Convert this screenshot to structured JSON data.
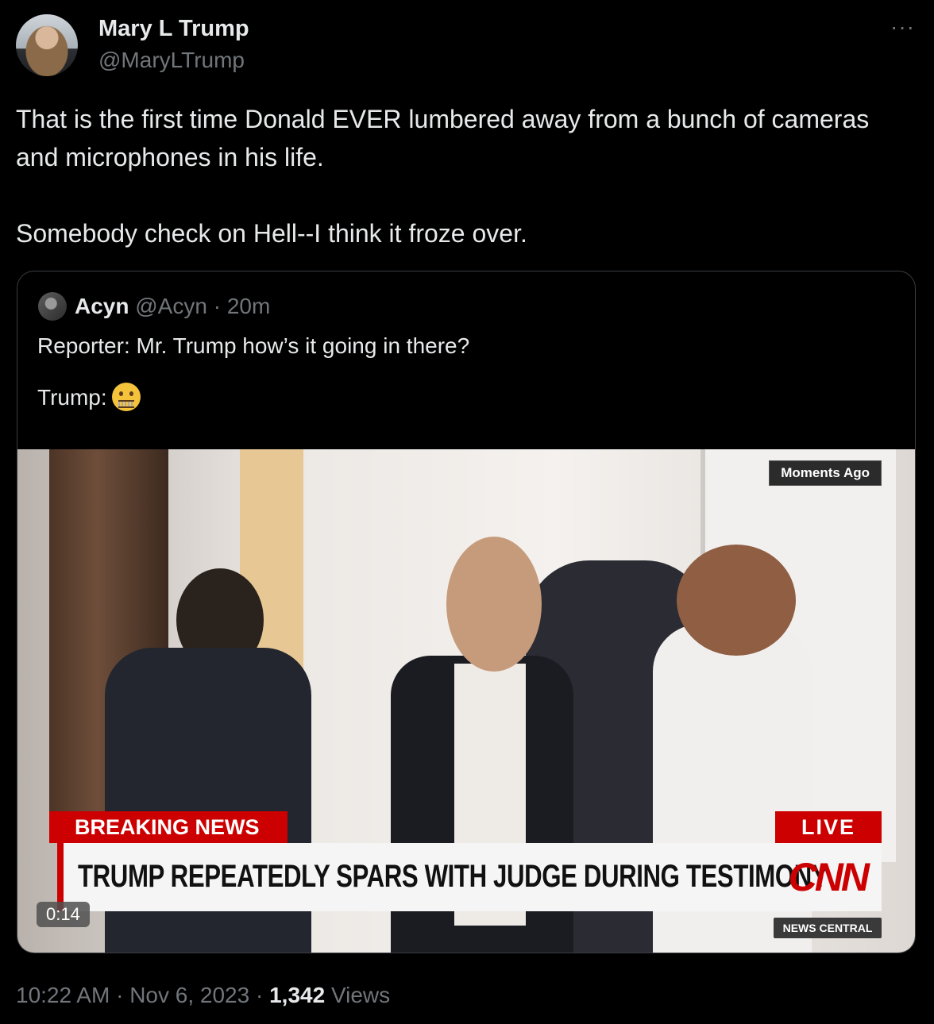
{
  "author": {
    "name": "Mary L Trump",
    "handle": "@MaryLTrump"
  },
  "more_icon": "more-horizontal-icon",
  "tweet": {
    "line1": "That is the first time Donald EVER lumbered away from a bunch of cameras and microphones in his life.",
    "line2": "Somebody check on Hell--I think it froze over."
  },
  "quote": {
    "name": "Acyn",
    "handle": "@Acyn",
    "time": "20m",
    "text1": "Reporter: Mr. Trump how’s it going in there?",
    "text2": "Trump:",
    "emoji": "zipper-mouth-face",
    "video": {
      "moments": "Moments Ago",
      "breaking": "BREAKING NEWS",
      "live": "LIVE",
      "headline": "TRUMP REPEATEDLY SPARS WITH JUDGE DURING TESTIMONY",
      "logo": "CNN",
      "network": "NEWS CENTRAL",
      "duration": "0:14"
    }
  },
  "footer": {
    "time": "10:22 AM",
    "date": "Nov 6, 2023",
    "views_count": "1,342",
    "views_label": "Views"
  },
  "colors": {
    "background": "#000000",
    "text": "#e7e9ea",
    "muted": "#71767b",
    "cnn_red": "#cc0000"
  }
}
